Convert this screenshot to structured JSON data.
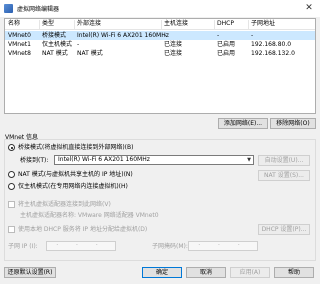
{
  "window": {
    "title": "虚拟网络编辑器",
    "close_glyph": "✕"
  },
  "table": {
    "headers": [
      "名称",
      "类型",
      "外部连接",
      "主机连接",
      "DHCP",
      "子网地址"
    ],
    "rows": [
      {
        "name": "VMnet0",
        "type": "桥接模式",
        "external": "Intel(R) Wi-Fi 6 AX201 160MHz",
        "host": "-",
        "dhcp": "-",
        "subnet": "-"
      },
      {
        "name": "VMnet1",
        "type": "仅主机模式",
        "external": "-",
        "host": "已连接",
        "dhcp": "已启用",
        "subnet": "192.168.80.0"
      },
      {
        "name": "VMnet8",
        "type": "NAT 模式",
        "external": "NAT 模式",
        "host": "已连接",
        "dhcp": "已启用",
        "subnet": "192.168.132.0"
      }
    ]
  },
  "buttons": {
    "add_network": "添加网络(E)...",
    "remove_network": "移除网络(O)",
    "auto_settings": "自动设置(U)...",
    "nat_settings": "NAT 设置(S)...",
    "dhcp_settings": "DHCP 设置(P)...",
    "restore_defaults": "还原默认设置(R)",
    "ok": "确定",
    "cancel": "取消",
    "apply": "应用(A)",
    "help": "帮助"
  },
  "vmnet_info": {
    "title": "VMnet 信息",
    "bridged_label": "桥接模式(将虚拟机直接连接到外部网络)(B)",
    "bridged_to_label": "桥接到(T):",
    "bridged_to_value": "Intel(R) Wi-Fi 6 AX201 160MHz",
    "nat_label": "NAT 模式(与虚拟机共享主机的 IP 地址)(N)",
    "hostonly_label": "仅主机模式(在专用网络内连接虚拟机)(H)",
    "connect_adapter_label": "将主机虚拟适配器连接到此网络(V)",
    "adapter_name_text": "主机虚拟适配器名称: VMware 网络适配器 VMnet0",
    "use_dhcp_label": "使用本地 DHCP 服务将 IP 地址分配给虚拟机(D)",
    "subnet_ip_label": "子网 IP (I):",
    "subnet_ip_value": "· · ·",
    "subnet_mask_label": "子网掩码(M):",
    "subnet_mask_value": "· · ·"
  }
}
